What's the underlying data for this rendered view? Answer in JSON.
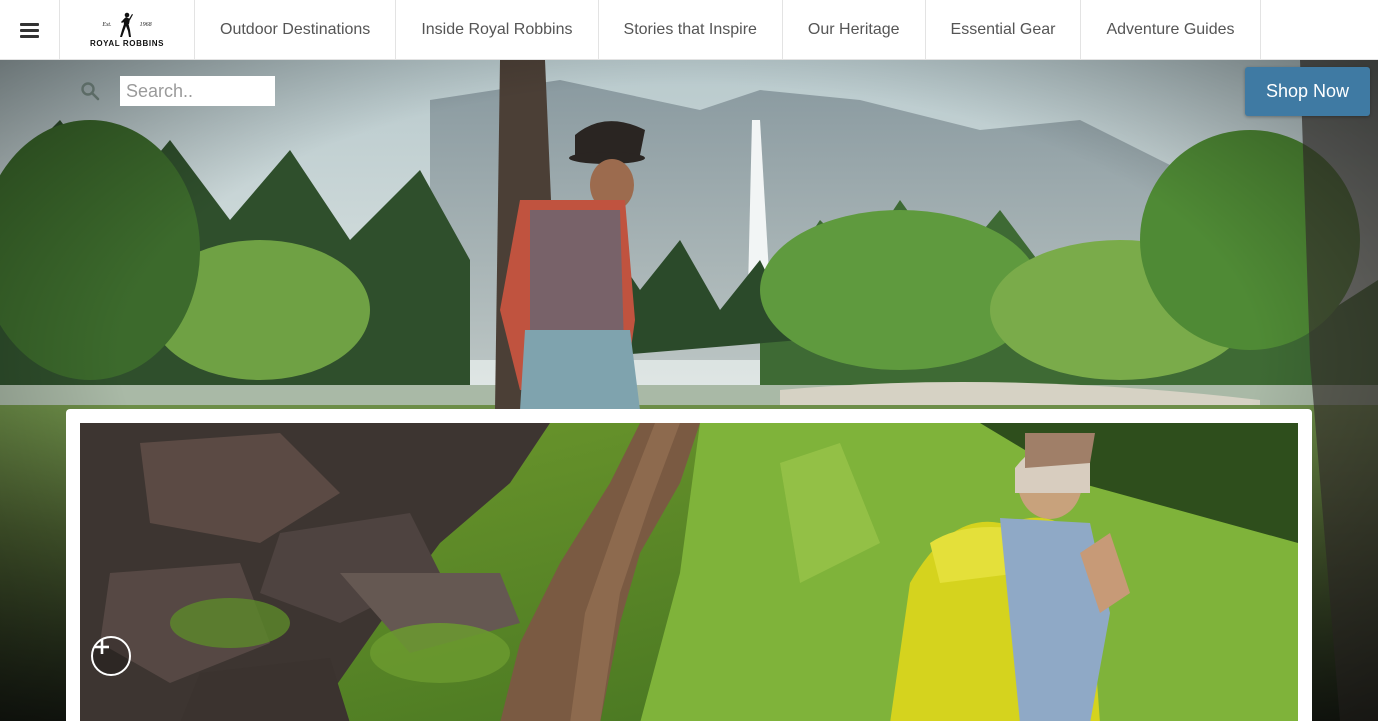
{
  "header": {
    "menu_icon": "hamburger-icon",
    "logo": {
      "est_left": "Est.",
      "est_right": "1968",
      "brand": "ROYAL ROBBINS",
      "icon": "climber-logo-icon"
    },
    "nav_items": [
      {
        "label": "Outdoor Destinations"
      },
      {
        "label": "Inside Royal Robbins"
      },
      {
        "label": "Stories that Inspire"
      },
      {
        "label": "Our Heritage"
      },
      {
        "label": "Essential Gear"
      },
      {
        "label": "Adventure Guides"
      }
    ]
  },
  "search": {
    "icon": "search-icon",
    "placeholder": "Search..",
    "value": ""
  },
  "cta": {
    "label": "Shop Now",
    "color": "#3f7aa3"
  },
  "card": {
    "expand_icon": "plus-icon"
  },
  "colors": {
    "nav_text": "#555555",
    "nav_border": "#e3e3e3"
  }
}
